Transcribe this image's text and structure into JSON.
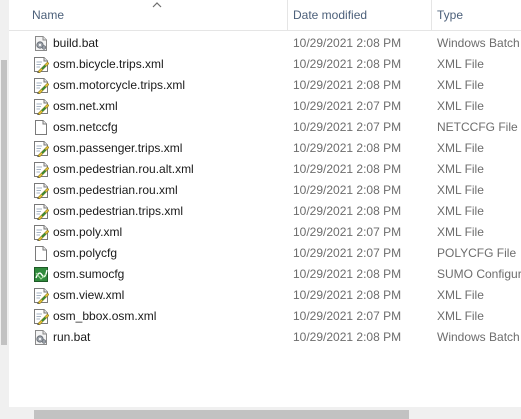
{
  "columns": {
    "name": "Name",
    "date": "Date modified",
    "type": "Type"
  },
  "files": [
    {
      "name": "build.bat",
      "date": "10/29/2021 2:08 PM",
      "type": "Windows Batch",
      "icon": "batch-file-icon"
    },
    {
      "name": "osm.bicycle.trips.xml",
      "date": "10/29/2021 2:08 PM",
      "type": "XML File",
      "icon": "xml-file-icon"
    },
    {
      "name": "osm.motorcycle.trips.xml",
      "date": "10/29/2021 2:08 PM",
      "type": "XML File",
      "icon": "xml-file-icon"
    },
    {
      "name": "osm.net.xml",
      "date": "10/29/2021 2:07 PM",
      "type": "XML File",
      "icon": "xml-file-icon"
    },
    {
      "name": "osm.netccfg",
      "date": "10/29/2021 2:07 PM",
      "type": "NETCCFG File",
      "icon": "blank-file-icon"
    },
    {
      "name": "osm.passenger.trips.xml",
      "date": "10/29/2021 2:08 PM",
      "type": "XML File",
      "icon": "xml-file-icon"
    },
    {
      "name": "osm.pedestrian.rou.alt.xml",
      "date": "10/29/2021 2:08 PM",
      "type": "XML File",
      "icon": "xml-file-icon"
    },
    {
      "name": "osm.pedestrian.rou.xml",
      "date": "10/29/2021 2:08 PM",
      "type": "XML File",
      "icon": "xml-file-icon"
    },
    {
      "name": "osm.pedestrian.trips.xml",
      "date": "10/29/2021 2:08 PM",
      "type": "XML File",
      "icon": "xml-file-icon"
    },
    {
      "name": "osm.poly.xml",
      "date": "10/29/2021 2:07 PM",
      "type": "XML File",
      "icon": "xml-file-icon"
    },
    {
      "name": "osm.polycfg",
      "date": "10/29/2021 2:07 PM",
      "type": "POLYCFG File",
      "icon": "blank-file-icon"
    },
    {
      "name": "osm.sumocfg",
      "date": "10/29/2021 2:08 PM",
      "type": "SUMO Configur",
      "icon": "sumo-config-icon"
    },
    {
      "name": "osm.view.xml",
      "date": "10/29/2021 2:08 PM",
      "type": "XML File",
      "icon": "xml-file-icon"
    },
    {
      "name": "osm_bbox.osm.xml",
      "date": "10/29/2021 2:07 PM",
      "type": "XML File",
      "icon": "xml-file-icon"
    },
    {
      "name": "run.bat",
      "date": "10/29/2021 2:08 PM",
      "type": "Windows Batch",
      "icon": "batch-file-icon"
    }
  ],
  "colors": {
    "header_text": "#4c607a",
    "secondary_text": "#6d6d6d",
    "scrollbar_track": "#f0f0f0",
    "scrollbar_thumb": "#c2c2c2"
  }
}
